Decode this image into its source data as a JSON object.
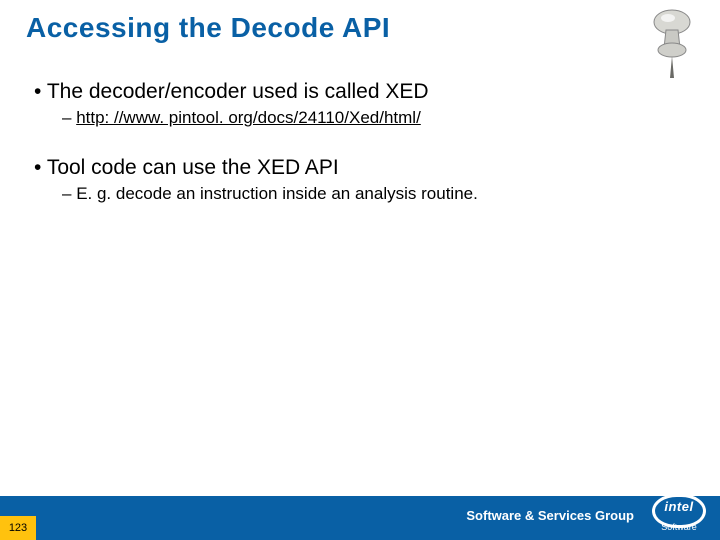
{
  "title": "Accessing the Decode API",
  "bullets": {
    "p1": "The decoder/encoder used is called XED",
    "p1a": "http: //www. pintool. org/docs/24110/Xed/html/",
    "p2": "Tool code can use the XED API",
    "p2a": "E. g. decode an instruction inside an analysis routine."
  },
  "footer": {
    "group": "Software & Services Group",
    "brand": "intel",
    "brand_sub": "Software",
    "page": "123"
  }
}
